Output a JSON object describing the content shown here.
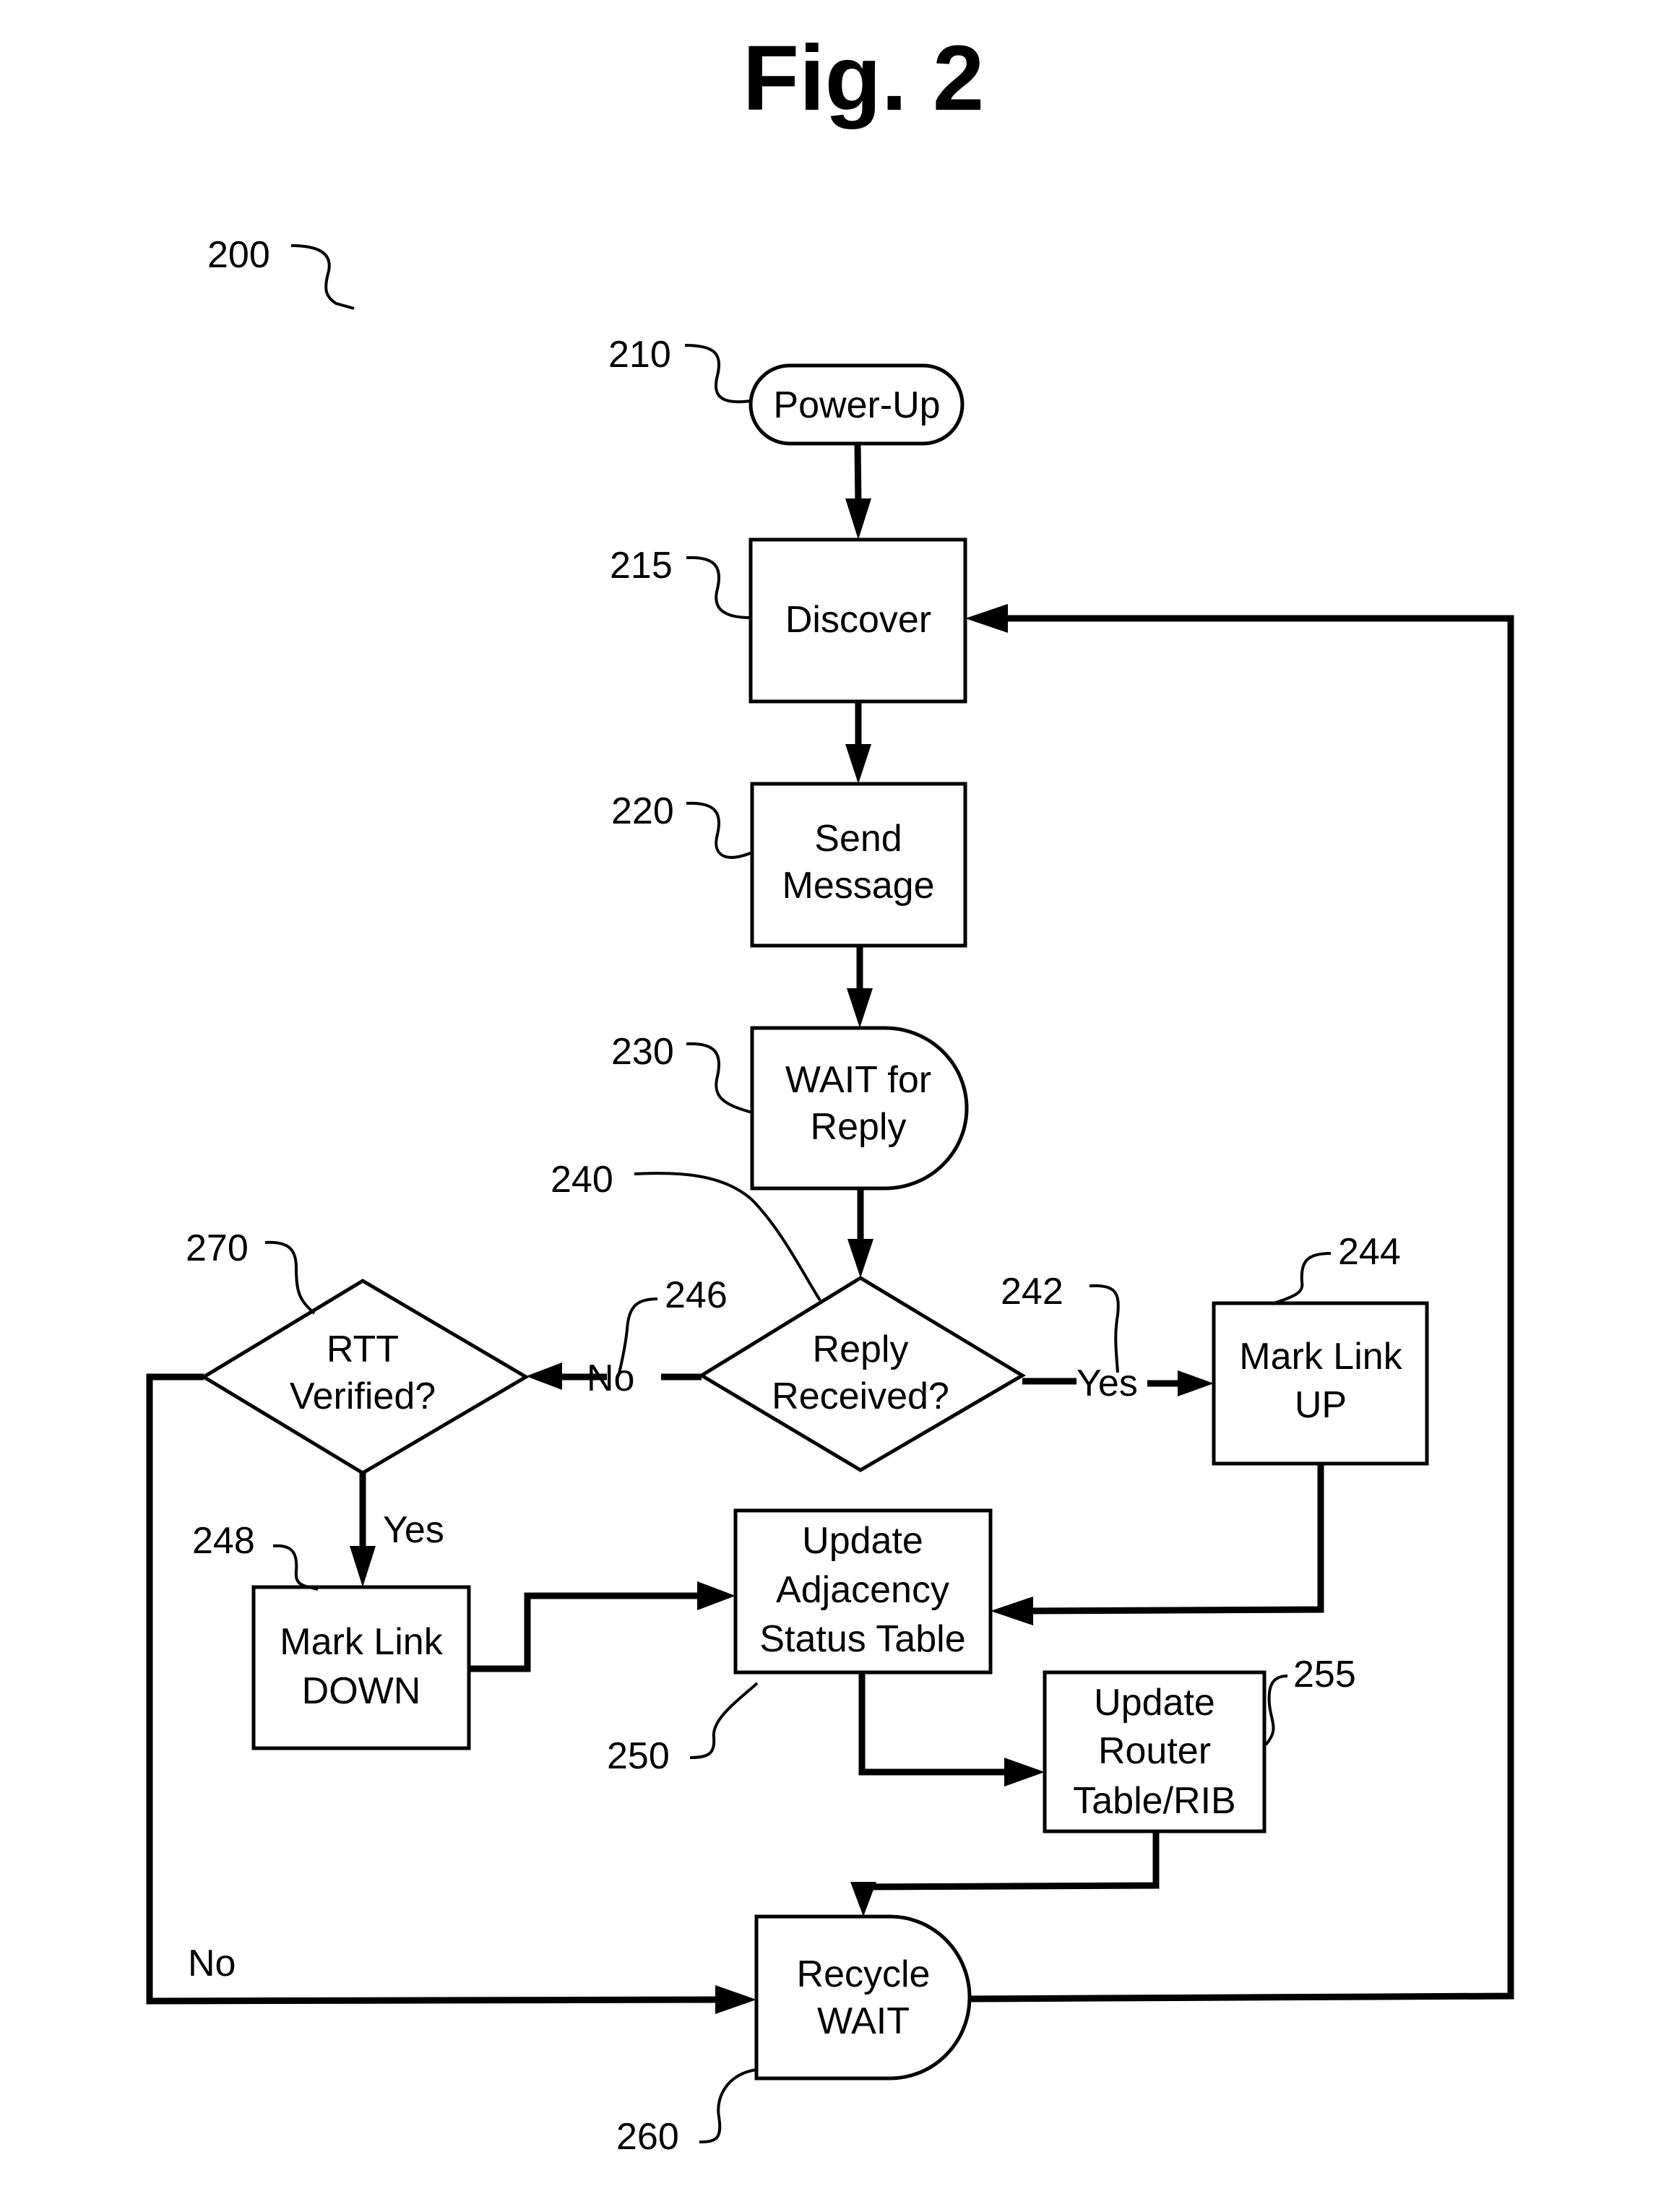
{
  "figure": {
    "title": "Fig. 2",
    "reference": "200"
  },
  "nodes": {
    "power_up": {
      "ref": "210",
      "lines": [
        "Power-Up"
      ],
      "shape": "terminator"
    },
    "discover": {
      "ref": "215",
      "lines": [
        "Discover"
      ],
      "shape": "process"
    },
    "send_message": {
      "ref": "220",
      "lines": [
        "Send",
        "Message"
      ],
      "shape": "process"
    },
    "wait_for_reply": {
      "ref": "230",
      "lines": [
        "WAIT for",
        "Reply"
      ],
      "shape": "delay"
    },
    "reply_received": {
      "ref": "240",
      "lines": [
        "Reply",
        "Received?"
      ],
      "shape": "decision"
    },
    "mark_link_up": {
      "ref": "244",
      "lines": [
        "Mark Link",
        "UP"
      ],
      "shape": "process"
    },
    "rtt_verified": {
      "ref": "270",
      "lines": [
        "RTT",
        "Verified?"
      ],
      "shape": "decision"
    },
    "mark_link_down": {
      "ref": "248",
      "lines": [
        "Mark Link",
        "DOWN"
      ],
      "shape": "process"
    },
    "update_adjacency": {
      "ref": "250",
      "lines": [
        "Update",
        "Adjacency",
        "Status Table"
      ],
      "shape": "process"
    },
    "update_router": {
      "ref": "255",
      "lines": [
        "Update",
        "Router",
        "Table/RIB"
      ],
      "shape": "process"
    },
    "recycle_wait": {
      "ref": "260",
      "lines": [
        "Recycle",
        "WAIT"
      ],
      "shape": "delay"
    }
  },
  "edges": {
    "reply_yes": {
      "label": "Yes",
      "ref": "242"
    },
    "reply_no": {
      "label": "No",
      "ref": "246"
    },
    "rtt_yes": {
      "label": "Yes"
    },
    "rtt_no": {
      "label": "No"
    }
  },
  "connections": [
    [
      "power_up",
      "discover"
    ],
    [
      "discover",
      "send_message"
    ],
    [
      "send_message",
      "wait_for_reply"
    ],
    [
      "wait_for_reply",
      "reply_received"
    ],
    [
      "reply_received",
      "mark_link_up",
      "Yes"
    ],
    [
      "reply_received",
      "rtt_verified",
      "No"
    ],
    [
      "rtt_verified",
      "mark_link_down",
      "Yes"
    ],
    [
      "rtt_verified",
      "recycle_wait",
      "No"
    ],
    [
      "mark_link_down",
      "update_adjacency"
    ],
    [
      "mark_link_up",
      "update_adjacency"
    ],
    [
      "update_adjacency",
      "update_router"
    ],
    [
      "update_router",
      "recycle_wait"
    ],
    [
      "recycle_wait",
      "discover"
    ]
  ]
}
